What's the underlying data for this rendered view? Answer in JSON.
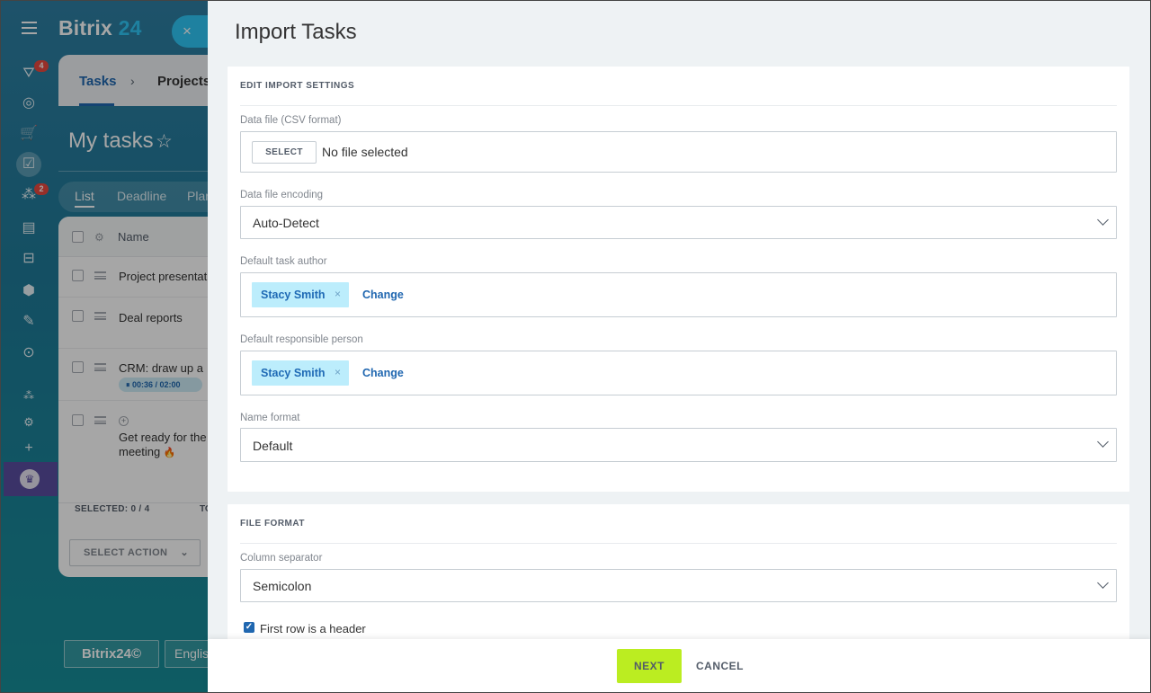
{
  "background": {
    "logo": {
      "brand": "Bitrix",
      "number": "24"
    },
    "close_icon": "×",
    "rail": {
      "filter_badge": "4",
      "chat_badge": "2"
    },
    "breadcrumb": {
      "tasks": "Tasks",
      "separator": "›",
      "projects": "Projects"
    },
    "page_title": "My tasks",
    "star_icon": "☆",
    "view_tabs": {
      "list": "List",
      "deadline": "Deadline",
      "planner": "Planner"
    },
    "table": {
      "header_name": "Name",
      "rows": [
        {
          "title": "Project presentation"
        },
        {
          "title": "Deal reports"
        },
        {
          "title": "CRM: draw up a",
          "timer": "⏸ 00:36 / 02:00"
        },
        {
          "title_line1": "Get ready for the",
          "title_line2": "meeting",
          "fire": "🔥"
        }
      ],
      "selected_label": "SELECTED:",
      "selected_value": "0 / 4",
      "total_label": "TO",
      "select_action": "SELECT ACTION"
    },
    "footer": {
      "logo": "Bitrix24©",
      "language": "English"
    }
  },
  "slider": {
    "title": "Import Tasks",
    "section_settings": {
      "title": "EDIT IMPORT SETTINGS",
      "data_file": {
        "label": "Data file (CSV format)",
        "button": "SELECT",
        "status": "No file selected"
      },
      "encoding": {
        "label": "Data file encoding",
        "value": "Auto-Detect"
      },
      "author": {
        "label": "Default task author",
        "user": "Stacy Smith",
        "remove": "×",
        "change": "Change"
      },
      "responsible": {
        "label": "Default responsible person",
        "user": "Stacy Smith",
        "remove": "×",
        "change": "Change"
      },
      "name_format": {
        "label": "Name format",
        "value": "Default"
      }
    },
    "section_format": {
      "title": "FILE FORMAT",
      "separator": {
        "label": "Column separator",
        "value": "Semicolon"
      },
      "header_row": {
        "label": "First row is a header",
        "checked": true
      }
    },
    "buttons": {
      "next": "NEXT",
      "cancel": "CANCEL"
    }
  },
  "colors": {
    "accent_blue": "#2067b0",
    "next_green": "#bbed21",
    "chip_bg": "#bcedfc",
    "close_button": "#2fc6f6"
  }
}
